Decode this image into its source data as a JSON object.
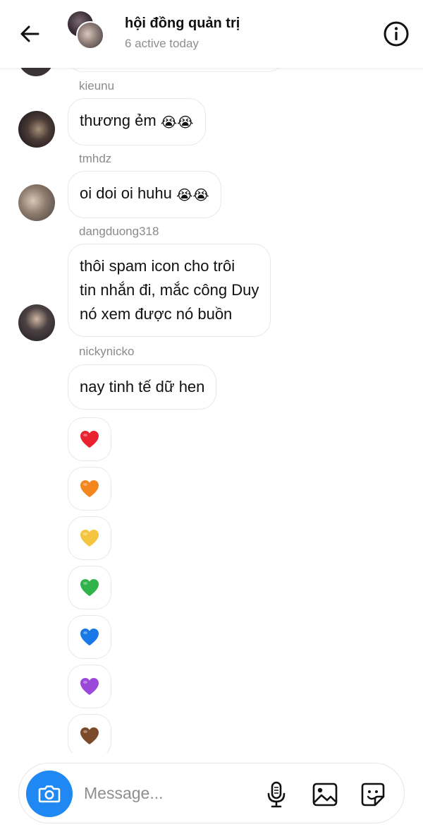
{
  "header": {
    "title": "hội đồng quản trị",
    "subtitle": "6 active today"
  },
  "messages": [
    {
      "sender": "kieunu",
      "text": "thương ẻm",
      "emoji": "😭😭"
    },
    {
      "sender": "tmhdz",
      "text": "oi doi oi huhu",
      "emoji": "😭😭"
    },
    {
      "sender": "dangduong318",
      "lines": [
        "thôi spam icon cho trôi",
        "tin nhắn đi, mắc công Duy",
        "nó xem được nó buồn"
      ]
    },
    {
      "sender": "nickynicko",
      "text": "nay tinh tế dữ hen"
    }
  ],
  "hearts": [
    {
      "name": "red-heart-icon",
      "color": "#e8232f"
    },
    {
      "name": "orange-heart-icon",
      "color": "#f4861e"
    },
    {
      "name": "yellow-heart-icon",
      "color": "#f5c542"
    },
    {
      "name": "green-heart-icon",
      "color": "#2fb34a"
    },
    {
      "name": "blue-heart-icon",
      "color": "#1778e6"
    },
    {
      "name": "purple-heart-icon",
      "color": "#9b47d9"
    },
    {
      "name": "brown-heart-icon",
      "color": "#7b4a2a"
    }
  ],
  "composer": {
    "placeholder": "Message..."
  },
  "colors": {
    "accent": "#1f88f2",
    "secondary_text": "#8e8e8e"
  }
}
